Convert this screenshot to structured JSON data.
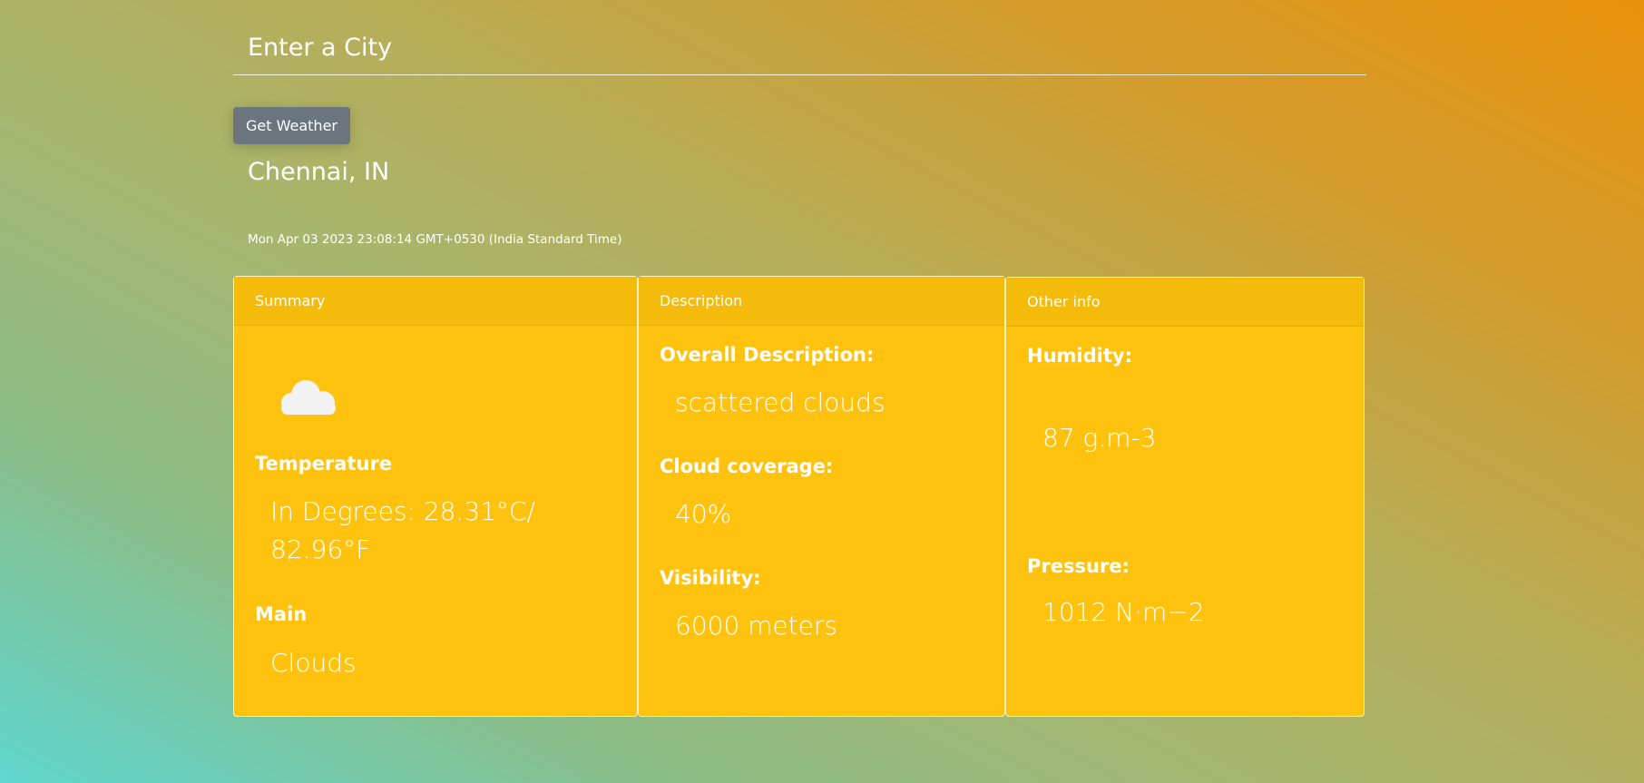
{
  "search": {
    "placeholder": "Enter a City"
  },
  "button": {
    "label": "Get Weather"
  },
  "location": "Chennai, IN",
  "datetime": "Mon Apr 03 2023 23:08:14 GMT+0530 (India Standard Time)",
  "summary": {
    "header": "Summary",
    "icon": "cloud-icon",
    "temperature_label": "Temperature",
    "temperature_value": "In Degrees: 28.31°C/ 82.96°F",
    "main_label": "Main",
    "main_value": "Clouds"
  },
  "description": {
    "header": "Description",
    "overall_label": "Overall Description:",
    "overall_value": "scattered clouds",
    "cloud_label": "Cloud coverage:",
    "cloud_value": "40%",
    "visibility_label": "Visibility:",
    "visibility_value": "6000 meters"
  },
  "other": {
    "header": "Other info",
    "humidity_label": "Humidity:",
    "humidity_value": "87 g.m-3",
    "pressure_label": "Pressure:",
    "pressure_value": "1012 N·m−2"
  },
  "colors": {
    "card_background": "#ffc20e",
    "card_header": "#f5bb0a",
    "button_background": "#6c757d"
  }
}
